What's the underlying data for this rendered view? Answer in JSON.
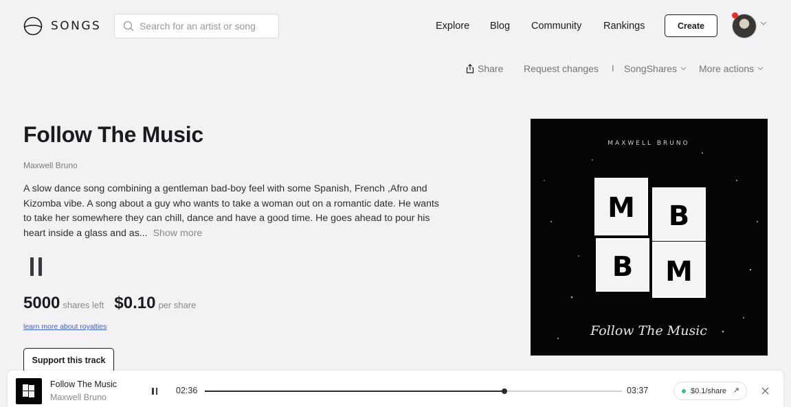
{
  "header": {
    "logo_text": "SONGS",
    "search_placeholder": "Search for an artist or song",
    "nav": [
      "Explore",
      "Blog",
      "Community",
      "Rankings"
    ],
    "create_label": "Create"
  },
  "actions": {
    "share": "Share",
    "request_changes": "Request changes",
    "separator": "I",
    "songshares": "SongShares",
    "more_actions": "More actions"
  },
  "song": {
    "title": "Follow The Music",
    "artist": "Maxwell Bruno",
    "description": "A slow dance song combining a gentleman bad-boy feel with some Spanish, French ,Afro and Kizomba vibe. A song about a guy who wants to take a woman out on a romantic date. He wants to take her somewhere they can chill, dance and have a good time. He goes ahead to pour his heart inside a glass and as...",
    "show_more": "Show more",
    "shares_left": "5000",
    "shares_left_label": "shares left",
    "price": "$0.10",
    "price_label": "per share",
    "learn_link": "learn more about royalties",
    "support_label": "Support this track"
  },
  "cover": {
    "artist_line": "MAXWELL BRUNO",
    "letters": [
      "M",
      "B",
      "B",
      "M"
    ],
    "script_title": "Follow The Music"
  },
  "player": {
    "title": "Follow The Music",
    "artist": "Maxwell Bruno",
    "elapsed": "02:36",
    "duration": "03:37",
    "progress": 0.719,
    "price_chip": "$0.1/share"
  },
  "colors": {
    "background": "#f3f1f4",
    "link": "#3d62c4",
    "notification": "#e0312b",
    "live_dot": "#33c27a"
  }
}
